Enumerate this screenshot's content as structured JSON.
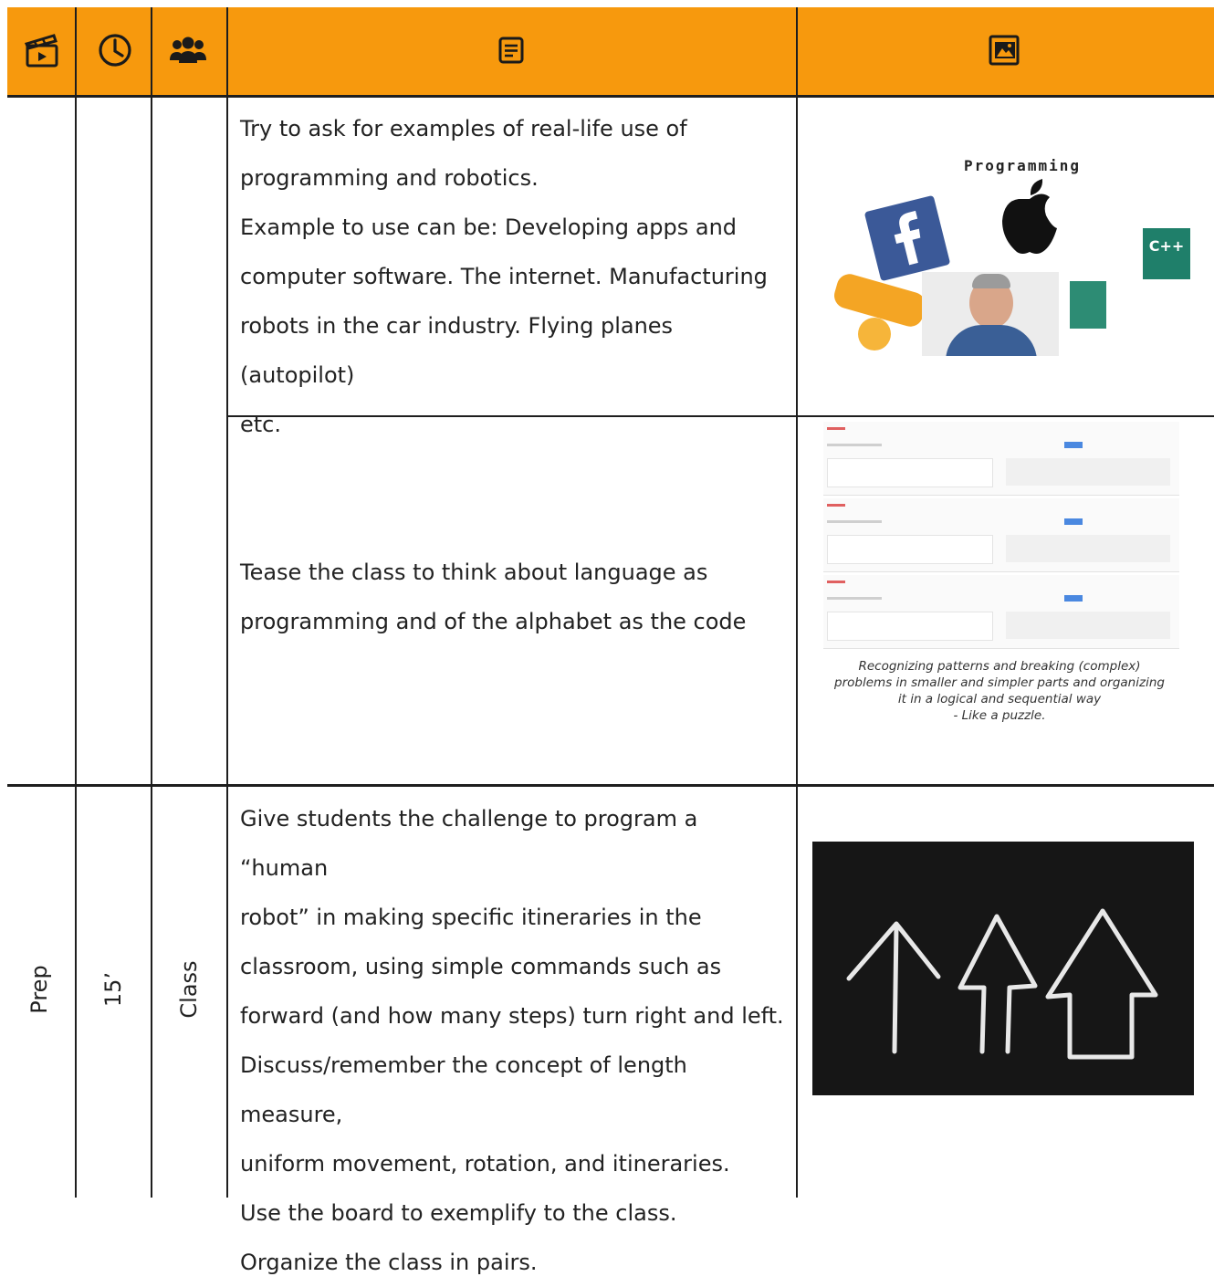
{
  "header": {
    "icons": [
      "clapperboard-icon",
      "clock-icon",
      "group-icon",
      "document-icon",
      "image-gallery-icon"
    ],
    "accent": "#f7990d"
  },
  "rows": {
    "row1": {
      "text": [
        "Try to ask for examples of real-life use of",
        "programming and robotics.",
        "Example to use can be: Developing apps and",
        "computer software. The internet. Manufacturing",
        "robots in the car industry. Flying planes (autopilot)",
        "etc."
      ],
      "collage_title": "Programming",
      "tile_label": "C++"
    },
    "row2": {
      "text": [
        "Tease the class to think about language as",
        "programming and of the alphabet as the code"
      ],
      "caption": [
        "Recognizing patterns and breaking (complex)",
        "problems in smaller and simpler parts and organizing",
        "it in a logical and sequential way",
        "- Like a puzzle."
      ]
    },
    "row3": {
      "phase": "Prep",
      "time": "15’",
      "grouping": "Class",
      "text": [
        "Give students the challenge to program a “human",
        "robot” in making specific itineraries in the",
        "classroom, using simple commands such as",
        "forward (and how many steps) turn right and left.",
        "Discuss/remember the concept of length measure,",
        "uniform movement, rotation, and itineraries.",
        "Use the board to exemplify to the class.",
        "Organize the class in pairs."
      ]
    }
  }
}
